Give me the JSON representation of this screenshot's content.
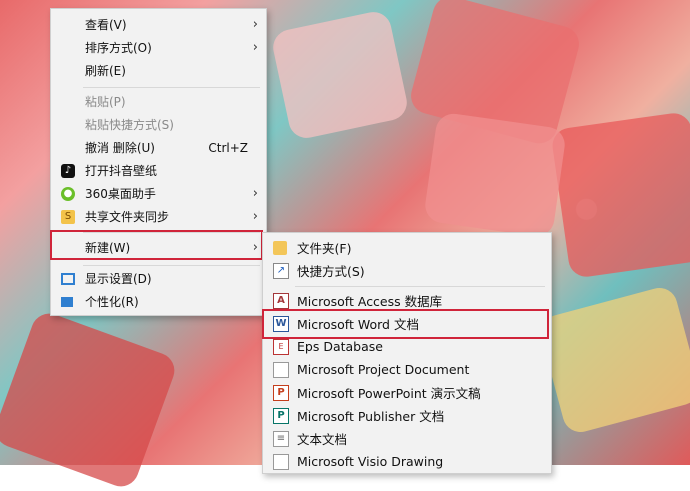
{
  "context_menu": {
    "items": [
      {
        "label": "查看(V)",
        "submenu": true
      },
      {
        "label": "排序方式(O)",
        "submenu": true
      },
      {
        "label": "刷新(E)"
      },
      {
        "label": "粘贴(P)",
        "disabled": true
      },
      {
        "label": "粘贴快捷方式(S)",
        "disabled": true
      },
      {
        "label": "撤消 删除(U)",
        "shortcut": "Ctrl+Z"
      },
      {
        "label": "打开抖音壁纸",
        "icon": "tiktok-icon"
      },
      {
        "label": "360桌面助手",
        "icon": "360-icon",
        "submenu": true
      },
      {
        "label": "共享文件夹同步",
        "icon": "share-sync-icon",
        "submenu": true
      },
      {
        "label": "新建(W)",
        "submenu": true,
        "highlighted": true
      },
      {
        "label": "显示设置(D)",
        "icon": "display-icon"
      },
      {
        "label": "个性化(R)",
        "icon": "personalize-icon"
      }
    ]
  },
  "new_submenu": {
    "items": [
      {
        "label": "文件夹(F)",
        "icon": "folder-icon"
      },
      {
        "label": "快捷方式(S)",
        "icon": "shortcut-icon"
      },
      {
        "label": "Microsoft Access 数据库",
        "icon": "access-icon"
      },
      {
        "label": "Microsoft Word 文档",
        "icon": "word-icon",
        "highlighted": true
      },
      {
        "label": "Eps Database",
        "icon": "eps-icon"
      },
      {
        "label": "Microsoft Project Document",
        "icon": "project-icon"
      },
      {
        "label": "Microsoft PowerPoint 演示文稿",
        "icon": "powerpoint-icon"
      },
      {
        "label": "Microsoft Publisher 文档",
        "icon": "publisher-icon"
      },
      {
        "label": "文本文档",
        "icon": "text-doc-icon"
      },
      {
        "label": "Microsoft Visio Drawing",
        "icon": "visio-icon"
      }
    ]
  },
  "colors": {
    "highlight_border": "#d0243a",
    "menu_bg": "#f2f2f2"
  }
}
